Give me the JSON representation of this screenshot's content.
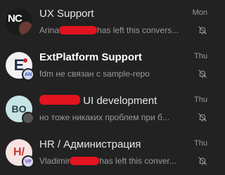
{
  "chats": [
    {
      "title": "UX Support",
      "time": "Mon",
      "preview_sender": "Arina",
      "preview_text": "has left this convers...",
      "avatar_text": "NC",
      "avatar_colors": {
        "bg": "#1a1a1a",
        "fg": "#ffffff",
        "accent": "#d32f2f"
      },
      "muted": true
    },
    {
      "title": "ExtPlatform Support",
      "time": "Thu",
      "preview_text": "fdm не связан с sample-repo",
      "avatar_text": "E",
      "sub_avatar_text": "AN",
      "avatar_colors": {
        "bg": "#f2f2f2",
        "fg": "#1d2b4a",
        "accent": "#cfd6ee"
      },
      "muted": true
    },
    {
      "title_suffix": "UI development",
      "time": "Thu",
      "preview_text": "но тоже никаких проблем при б...",
      "avatar_text": "BO",
      "avatar_colors": {
        "bg": "#c6e4e4",
        "fg": "#2c3d45",
        "accent": "#ffffff"
      },
      "muted": true
    },
    {
      "title": "HR / Администрация",
      "time": "Thu",
      "preview_sender": "Vladimir",
      "preview_text": "has left this conver...",
      "avatar_text": "H/",
      "sub_avatar_text": "VP",
      "avatar_colors": {
        "bg": "#f8e3e3",
        "fg": "#c0392b",
        "accent": "#d9d6f3"
      },
      "muted": true
    }
  ],
  "colors": {
    "background": "#222222",
    "redaction": "#e1141f"
  },
  "icons": {
    "mute": "bell-slash-icon"
  }
}
